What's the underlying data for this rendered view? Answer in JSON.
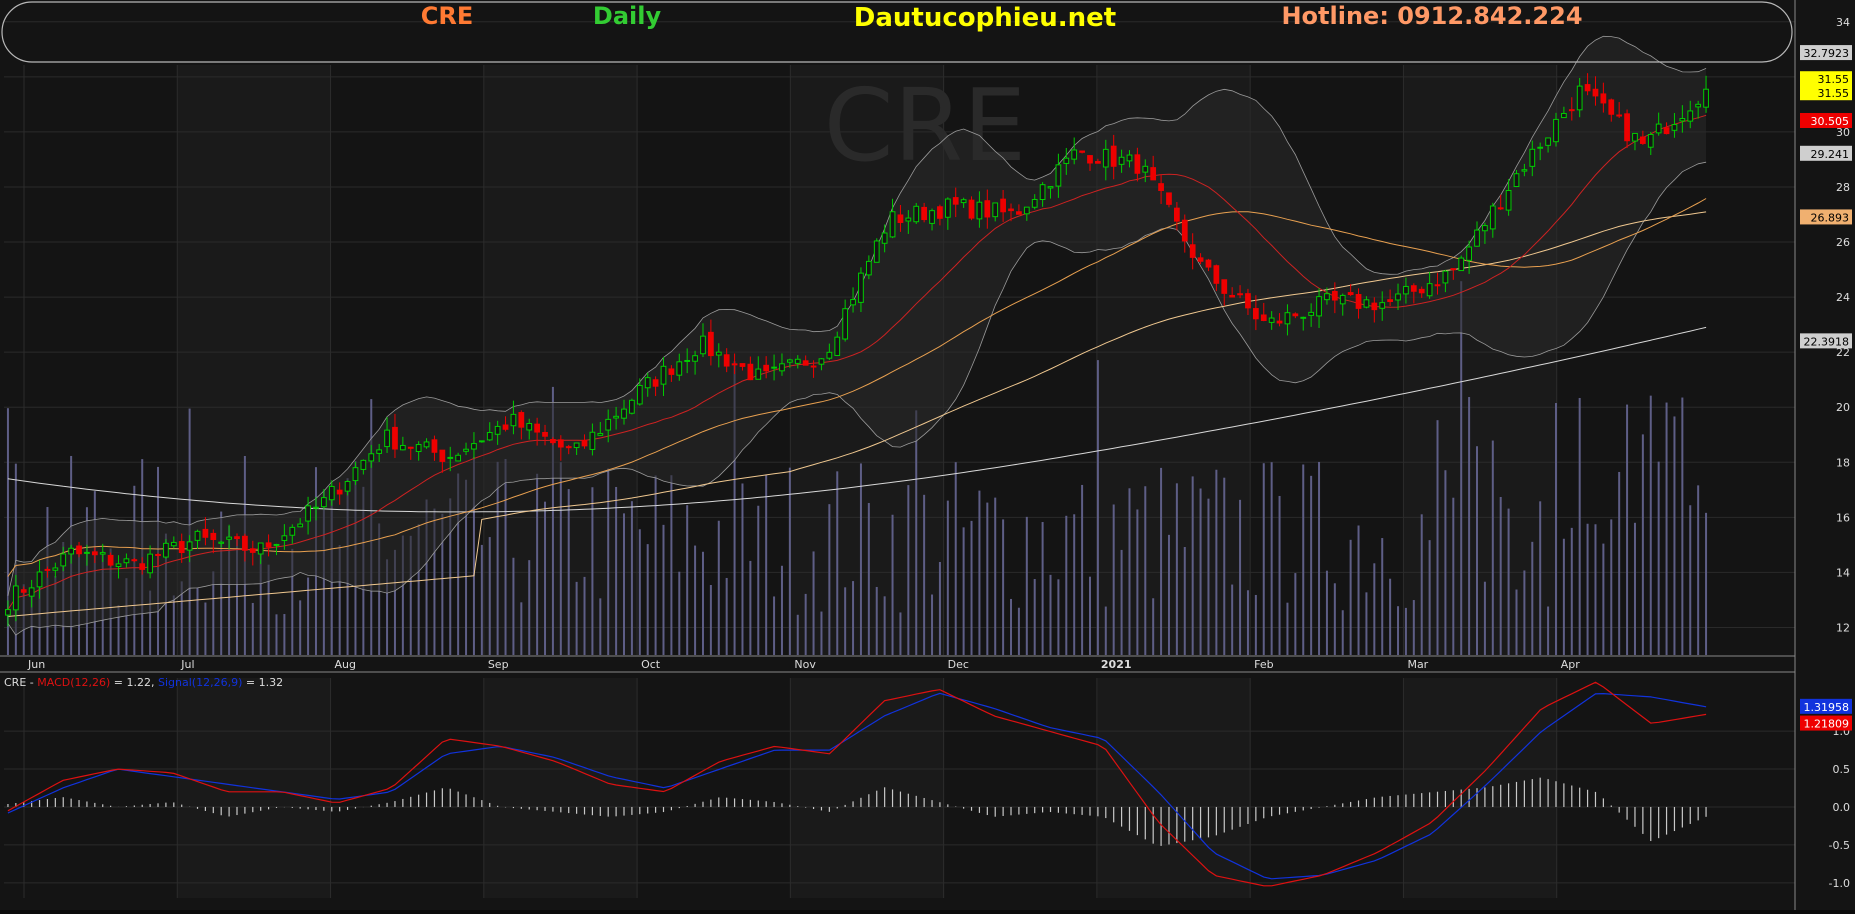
{
  "header": {
    "symbol": "CRE",
    "interval": "Daily",
    "site": "Dautucophieu.net",
    "hotline": "Hotline: 0912.842.224"
  },
  "colors": {
    "up": "#00cc00",
    "down": "#ee0000",
    "volume": "#5e5e86",
    "ma20": "#cc2222",
    "ma50": "#e8a050",
    "ma100": "#f0c890",
    "ma200": "#d8d8d8",
    "bollinger": "#9a9a9a",
    "macd": "#dd1111",
    "signal": "#1133dd",
    "hotline": "#ff9966",
    "site": "#ffff00",
    "interval": "#33cc33",
    "symbol": "#ff7a33"
  },
  "chart_data": [
    {
      "type": "candlestick",
      "title": "CRE",
      "x_month_labels": [
        "Jun",
        "Jul",
        "Aug",
        "Sep",
        "Oct",
        "Nov",
        "Dec",
        "2021",
        "Feb",
        "Mar",
        "Apr"
      ],
      "y_ticks": [
        12,
        14,
        16,
        18,
        20,
        22,
        24,
        26,
        28,
        30,
        32,
        34
      ],
      "ylim": [
        11,
        34.5
      ],
      "key_points": [
        {
          "label": "early Jun",
          "close": 13.0
        },
        {
          "label": "mid Jun",
          "close": 14.7
        },
        {
          "label": "early Jul",
          "close": 14.3
        },
        {
          "label": "mid Jul",
          "close": 15.2
        },
        {
          "label": "early Aug",
          "close": 14.8
        },
        {
          "label": "mid Aug",
          "close": 16.5
        },
        {
          "label": "early Sep",
          "close": 18.9
        },
        {
          "label": "mid Sep",
          "close": 18.2
        },
        {
          "label": "late Sep",
          "close": 19.5
        },
        {
          "label": "early Oct",
          "close": 18.3
        },
        {
          "label": "mid Oct",
          "close": 20.5
        },
        {
          "label": "late Oct",
          "close": 22.3
        },
        {
          "label": "early Nov",
          "close": 21.0
        },
        {
          "label": "mid Nov",
          "close": 22.0
        },
        {
          "label": "late Nov",
          "close": 26.8
        },
        {
          "label": "early Dec",
          "close": 27.3
        },
        {
          "label": "mid Dec",
          "close": 27.0
        },
        {
          "label": "late Dec",
          "close": 29.3
        },
        {
          "label": "early Jan",
          "close": 28.8
        },
        {
          "label": "mid Jan",
          "close": 25.0
        },
        {
          "label": "late Jan",
          "close": 23.0
        },
        {
          "label": "early Feb",
          "close": 23.8
        },
        {
          "label": "mid Feb",
          "close": 23.8
        },
        {
          "label": "early Mar",
          "close": 25.0
        },
        {
          "label": "mid Mar",
          "close": 28.5
        },
        {
          "label": "late Mar",
          "close": 31.5
        },
        {
          "label": "early Apr",
          "close": 29.5
        },
        {
          "label": "mid Apr",
          "close": 31.55
        }
      ],
      "price_labels": [
        "32.7923",
        "31.55",
        "31.55",
        "30.505",
        "29.241",
        "26.893",
        "22.3918"
      ]
    },
    {
      "type": "line",
      "title": "MACD",
      "legend": {
        "prefix": "CRE - ",
        "macd_label": "MACD(12,26)",
        "macd_value": " = 1.22, ",
        "signal_label": "Signal(12,26,9)",
        "signal_value": " = 1.32"
      },
      "y_ticks": [
        "-1.0",
        "-0.5",
        "0.0",
        "0.5",
        "1.0"
      ],
      "ylim": [
        -1.2,
        1.7
      ],
      "macd_key_points": [
        -0.05,
        0.35,
        0.5,
        0.45,
        0.2,
        0.2,
        0.05,
        0.25,
        0.9,
        0.8,
        0.6,
        0.3,
        0.2,
        0.6,
        0.8,
        0.7,
        1.4,
        1.55,
        1.2,
        1.0,
        0.8,
        -0.2,
        -0.9,
        -1.05,
        -0.9,
        -0.6,
        -0.2,
        0.5,
        1.3,
        1.65,
        1.1,
        1.22
      ],
      "signal_key_points": [
        -0.08,
        0.25,
        0.5,
        0.4,
        0.3,
        0.2,
        0.1,
        0.2,
        0.7,
        0.8,
        0.65,
        0.4,
        0.25,
        0.5,
        0.75,
        0.75,
        1.2,
        1.5,
        1.3,
        1.05,
        0.9,
        0.2,
        -0.6,
        -0.95,
        -0.9,
        -0.7,
        -0.35,
        0.3,
        1.0,
        1.5,
        1.45,
        1.32
      ],
      "price_labels": [
        "1.31958",
        "1.21809"
      ]
    }
  ]
}
